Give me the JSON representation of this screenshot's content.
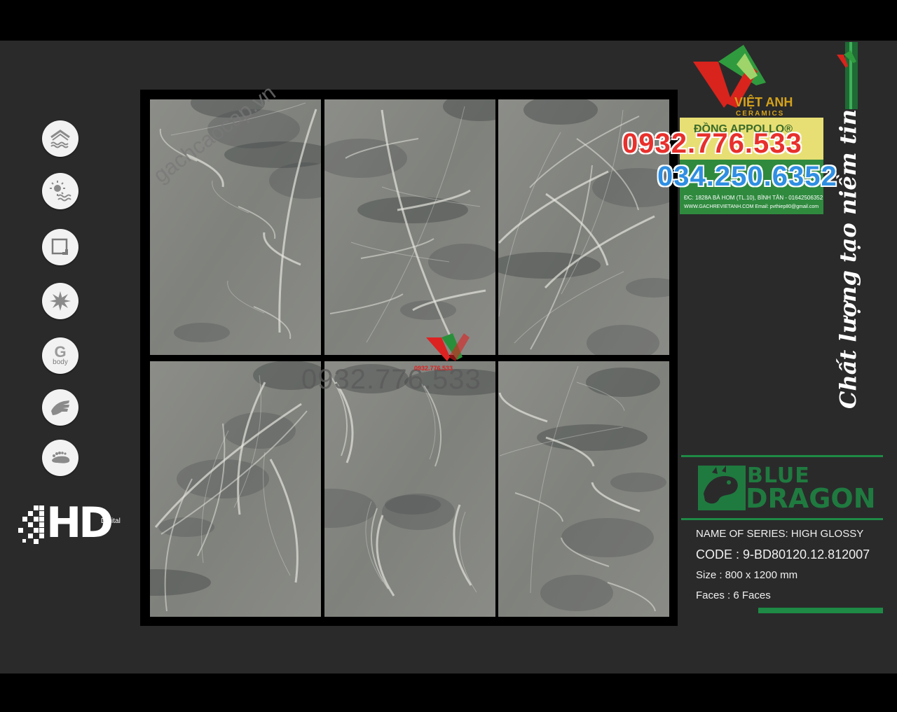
{
  "watermark": {
    "url": "gachcaocap.vn",
    "phone": "0932.776.533",
    "center_logo_phone": "0932.776.533"
  },
  "features": {
    "icons": [
      "roof-wave-icon",
      "sun-wave-icon",
      "square-edge-icon",
      "burst-icon",
      "g-body-icon",
      "hand-icon",
      "foot-icon"
    ],
    "gbody_letter": "G",
    "gbody_label": "body",
    "hd_label": "HD",
    "hd_sub": "Digital"
  },
  "dealer": {
    "name": "VIỆT ANH",
    "sub": "CERAMICS",
    "card_brand": "ĐỒNG APPOLLO®",
    "card_address": "ĐC: 1828A BÀ HOM (TL.10), BÌNH TÂN - 01642506352",
    "card_web": "WWW.GACHREVIETANH.COM  Email: pvthiep80@gmail.com",
    "phone_1": "0932.776.533",
    "phone_2": "034.250.6352",
    "slogan": "Chất lượng tạo niềm tin"
  },
  "brand": {
    "line1": "BLUE",
    "line2": "DRAGON"
  },
  "specs": {
    "series": "NAME OF SERIES:  HIGH GLOSSY",
    "code": "CODE  :  9-BD80120.12.812007",
    "size": "Size    :  800 x 1200 mm",
    "faces": "Faces  :  6 Faces"
  },
  "colors": {
    "background": "#2a2a2b",
    "frame": "#000000",
    "brand_green": "#1f7a3f",
    "phone_red": "#e8302c",
    "phone_blue": "#2f8fe2",
    "dealer_gold": "#d4a21b"
  }
}
